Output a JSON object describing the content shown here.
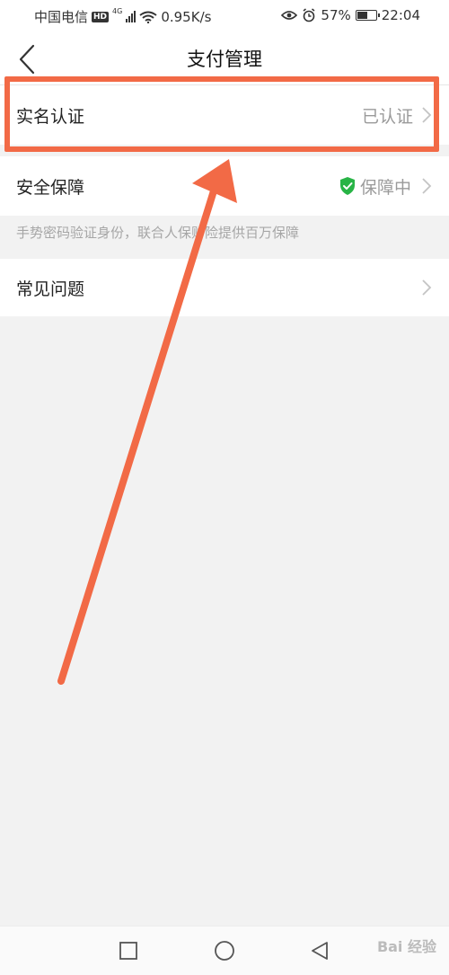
{
  "status_bar": {
    "carrier": "中国电信",
    "hd_badge": "HD",
    "network_type": "4G",
    "speed": "0.95K/s",
    "battery": "57%",
    "battery_level": 0.57,
    "time": "22:04",
    "icons": [
      "hd-icon",
      "signal-icon",
      "wifi-icon",
      "eye-icon",
      "alarm-icon",
      "battery-icon"
    ]
  },
  "header": {
    "title": "支付管理",
    "back_icon": "chevron-left-icon"
  },
  "settings": {
    "rows": [
      {
        "label": "实名认证",
        "value": "已认证"
      },
      {
        "label": "安全保障",
        "value": "保障中",
        "badge_icon": "shield-check-icon",
        "badge_color": "#28b446"
      },
      {
        "label": "常见问题",
        "value": ""
      }
    ],
    "security_note": "手势密码验证身份，联合人保财险提供百万保障"
  },
  "annotation": {
    "color": "#f26a46"
  },
  "bottom_nav": {
    "icons": [
      "recent-apps-icon",
      "home-icon",
      "back-icon"
    ]
  },
  "watermark": "Bai 经验"
}
